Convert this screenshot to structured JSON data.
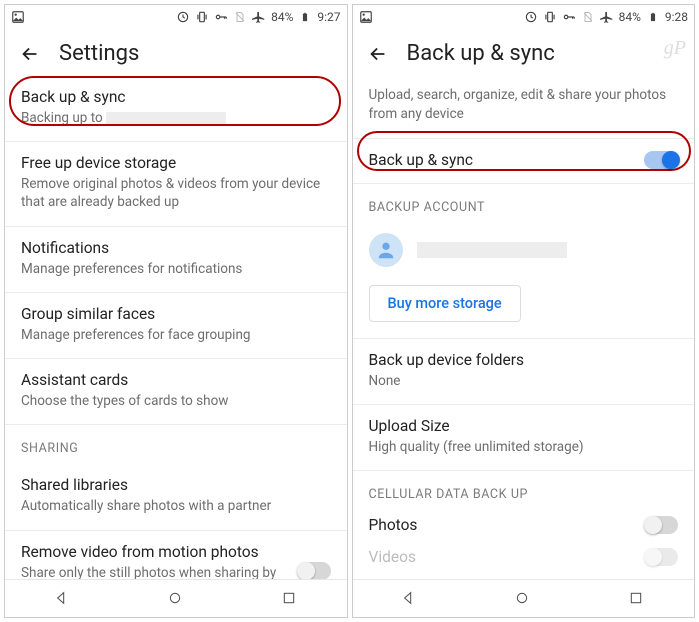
{
  "status": {
    "battery": "84%",
    "time_left": "9:27",
    "time_right": "9:28"
  },
  "left": {
    "title": "Settings",
    "items": [
      {
        "primary": "Back up & sync",
        "secondary_prefix": "Backing up to"
      },
      {
        "primary": "Free up device storage",
        "secondary": "Remove original photos & videos from your device that are already backed up"
      },
      {
        "primary": "Notifications",
        "secondary": "Manage preferences for notifications"
      },
      {
        "primary": "Group similar faces",
        "secondary": "Manage preferences for face grouping"
      },
      {
        "primary": "Assistant cards",
        "secondary": "Choose the types of cards to show"
      }
    ],
    "section_sharing": "SHARING",
    "shared_libraries": {
      "primary": "Shared libraries",
      "secondary": "Automatically share photos with a partner"
    },
    "remove_video": {
      "primary": "Remove video from motion photos",
      "secondary": "Share only the still photos when sharing by link & in albums"
    }
  },
  "right": {
    "title": "Back up & sync",
    "subtitle": "Upload, search, organize, edit & share your photos from any device",
    "backup_toggle_label": "Back up & sync",
    "section_backup_account": "BACKUP ACCOUNT",
    "buy_more": "Buy more storage",
    "device_folders": {
      "primary": "Back up device folders",
      "secondary": "None"
    },
    "upload_size": {
      "primary": "Upload Size",
      "secondary": "High quality (free unlimited storage)"
    },
    "section_cellular": "CELLULAR DATA BACK UP",
    "photos_label": "Photos",
    "videos_label": "Videos"
  },
  "watermark": "gP"
}
